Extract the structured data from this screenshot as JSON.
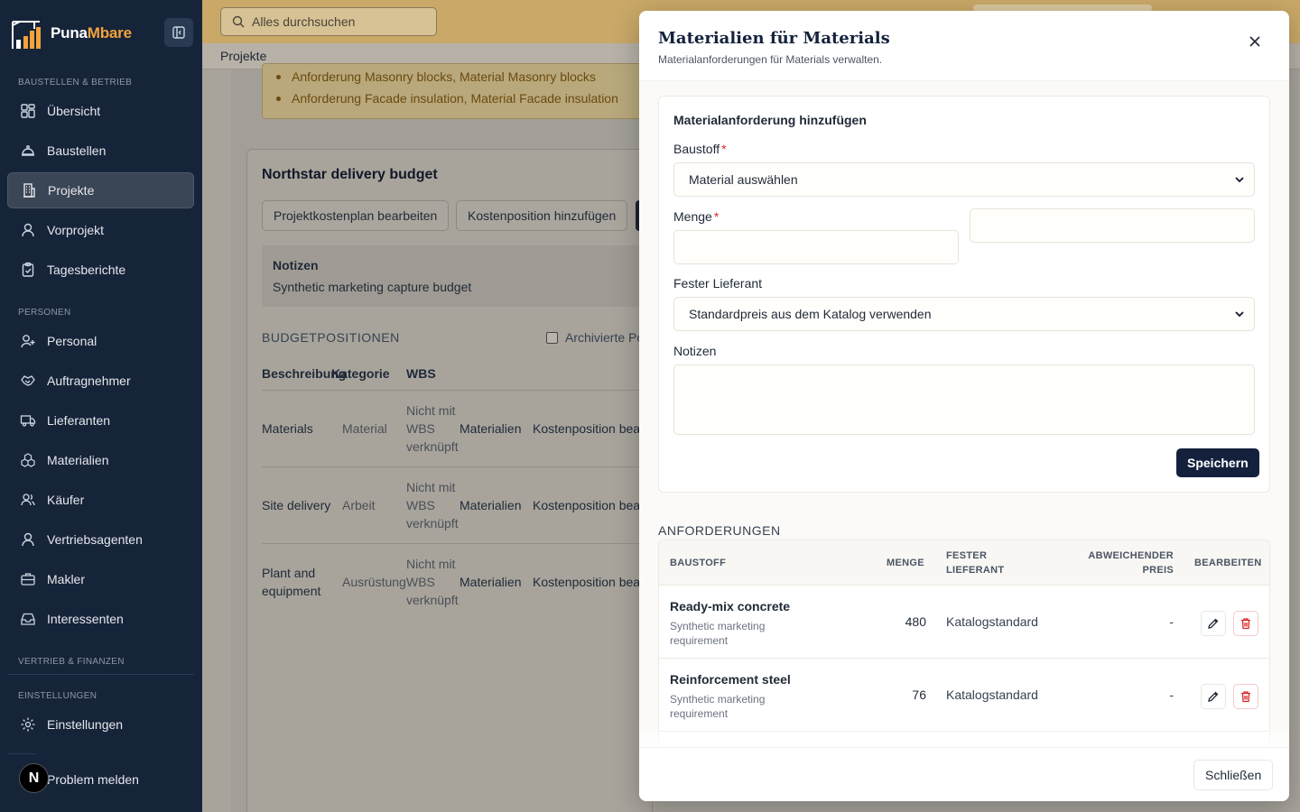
{
  "app": {
    "name_part1": "Puna",
    "name_part2": "Mbare",
    "accent_color": "#f2a33a",
    "sidebar_bg": "#16243a"
  },
  "sidebar": {
    "sections": [
      {
        "label": "BAUSTELLEN & BETRIEB"
      },
      {
        "label": "PERSONEN"
      },
      {
        "label": "VERTRIEB & FINANZEN"
      },
      {
        "label": "EINSTELLUNGEN"
      }
    ],
    "items": [
      {
        "label": "Übersicht",
        "icon": "grid-icon"
      },
      {
        "label": "Baustellen",
        "icon": "helmet-icon"
      },
      {
        "label": "Projekte",
        "icon": "building-icon",
        "active": true
      },
      {
        "label": "Vorprojekt",
        "icon": "user-icon"
      },
      {
        "label": "Tagesberichte",
        "icon": "clipboard-icon"
      },
      {
        "label": "Personal",
        "icon": "user-plus-icon"
      },
      {
        "label": "Auftragnehmer",
        "icon": "handshake-icon"
      },
      {
        "label": "Lieferanten",
        "icon": "truck-icon"
      },
      {
        "label": "Materialien",
        "icon": "boxes-icon"
      },
      {
        "label": "Käufer",
        "icon": "users-icon"
      },
      {
        "label": "Vertriebsagenten",
        "icon": "user-icon"
      },
      {
        "label": "Makler",
        "icon": "briefcase-icon"
      },
      {
        "label": "Interessenten",
        "icon": "inbox-icon"
      },
      {
        "label": "Einstellungen",
        "icon": "gear-icon"
      }
    ],
    "footer_link": "Problem melden",
    "avatar_letter": "N"
  },
  "header": {
    "search_placeholder": "Alles durchsuchen",
    "breadcrumb": "Projekte"
  },
  "background": {
    "alerts": [
      "Anforderung Masonry blocks, Material Masonry blocks",
      "Anforderung Facade insulation, Material Facade insulation"
    ],
    "budget_title": "Northstar delivery budget",
    "buttons": [
      "Projektkostenplan bearbeiten",
      "Kostenposition hinzufügen"
    ],
    "notes_title": "Notizen",
    "notes_text": "Synthetic marketing capture budget",
    "positions_title": "BUDGETPOSITIONEN",
    "archived_label": "Archivierte Po",
    "columns": [
      "Beschreibung",
      "Kategorie",
      "WBS"
    ],
    "rows": [
      {
        "desc": "Materials",
        "cat": "Material",
        "wbs": "Nicht mit WBS verknüpft",
        "group": "Materialien",
        "action": "Kostenposition bea"
      },
      {
        "desc": "Site delivery",
        "cat": "Arbeit",
        "wbs": "Nicht mit WBS verknüpft",
        "group": "Materialien",
        "action": "Kostenposition bea"
      },
      {
        "desc": "Plant and equipment",
        "cat": "Ausrüstung",
        "wbs": "Nicht mit WBS verknüpft",
        "group": "Materialien",
        "action": "Kostenposition bea"
      }
    ]
  },
  "modal": {
    "title": "Materialien für Materials",
    "subtitle": "Materialanforderungen für Materials verwalten.",
    "form": {
      "heading": "Materialanforderung hinzufügen",
      "material_label": "Baustoff",
      "material_value": "Material auswählen",
      "qty_label": "Menge",
      "qty_value": "",
      "supplier_label": "Fester Lieferant",
      "supplier_value": "Standardpreis aus dem Katalog verwenden",
      "notes_label": "Notizen",
      "notes_value": "",
      "save_label": "Speichern"
    },
    "requirements_title": "ANFORDERUNGEN",
    "table": {
      "headers": {
        "material": "BAUSTOFF",
        "qty": "MENGE",
        "supplier_1": "FESTER",
        "supplier_2": "LIEFERANT",
        "price_1": "ABWEICHENDER",
        "price_2": "PREIS",
        "edit": "BEARBEITEN"
      },
      "rows": [
        {
          "name": "Ready-mix concrete",
          "note": "Synthetic marketing requirement",
          "qty": "480",
          "supplier": "Katalogstandard",
          "price": "-"
        },
        {
          "name": "Reinforcement steel",
          "note": "Synthetic marketing requirement",
          "qty": "76",
          "supplier": "Katalogstandard",
          "price": "-"
        }
      ]
    },
    "close_label": "Schließen"
  }
}
